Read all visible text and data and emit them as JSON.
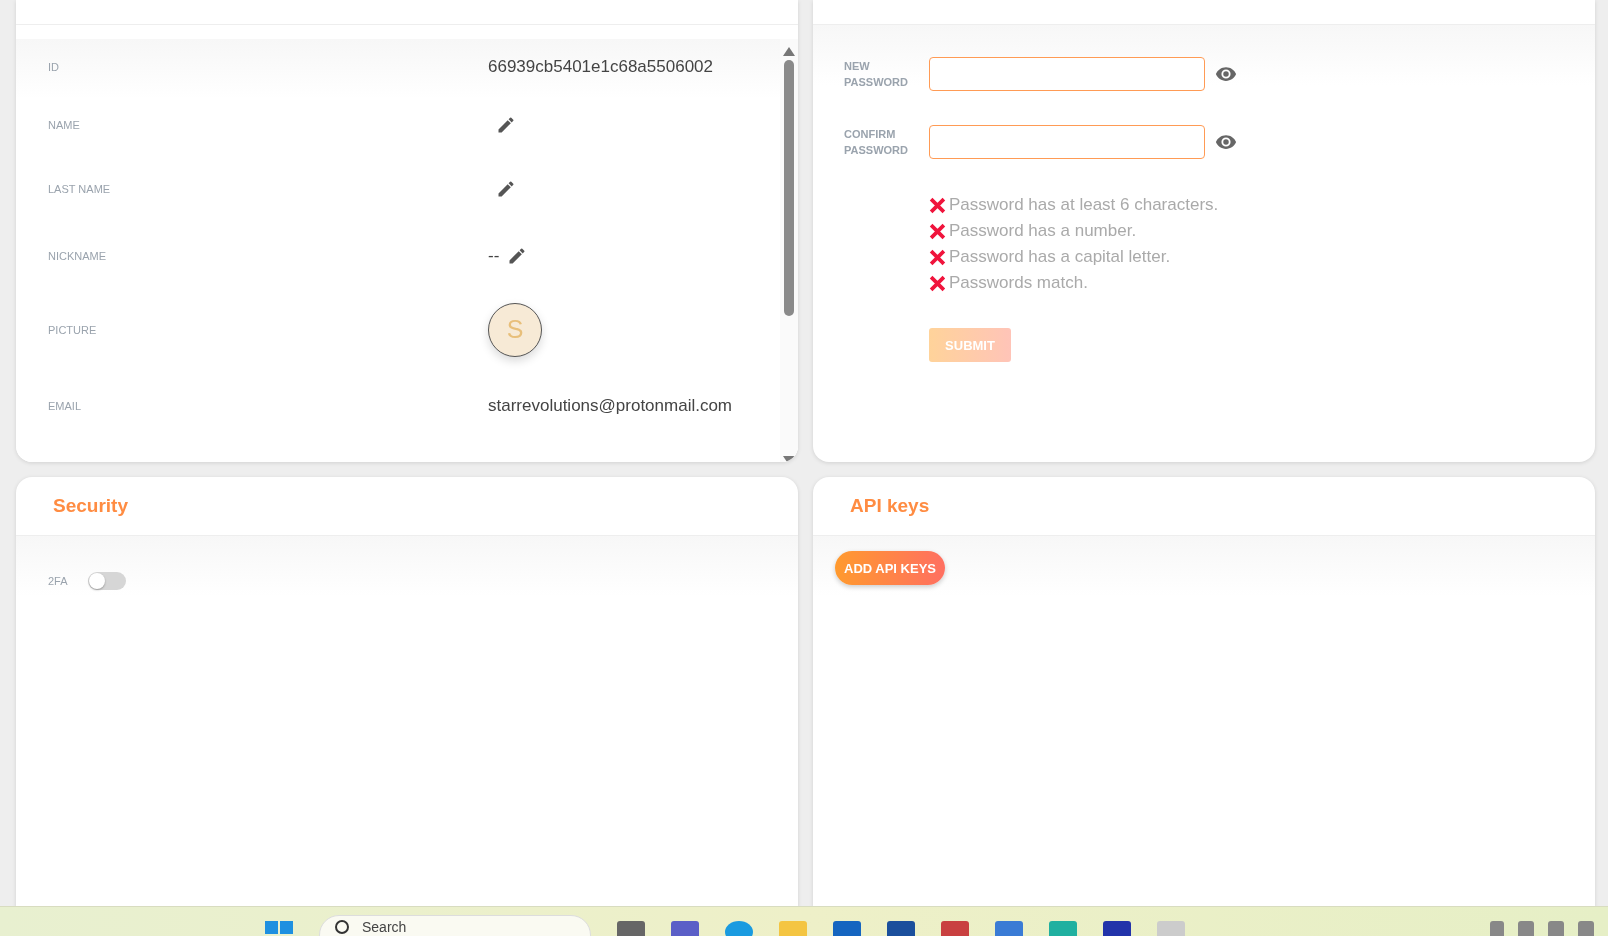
{
  "profile": {
    "fields": [
      {
        "label": "ID",
        "kind": "text",
        "value": "66939cb5401e1c68a5506002"
      },
      {
        "label": "NAME",
        "kind": "edit"
      },
      {
        "label": "LAST NAME",
        "kind": "edit"
      },
      {
        "label": "NICKNAME",
        "kind": "edit",
        "value": "--"
      },
      {
        "label": "PICTURE",
        "kind": "avatar",
        "value": "S"
      },
      {
        "label": "EMAIL",
        "kind": "text",
        "value": "starrevolutions@protonmail.com"
      }
    ]
  },
  "password": {
    "fields": [
      {
        "label": "NEW PASSWORD"
      },
      {
        "label": "CONFIRM PASSWORD"
      }
    ],
    "rules": [
      {
        "text": "Password has at least 6 characters.",
        "met": false
      },
      {
        "text": "Password has a number.",
        "met": false
      },
      {
        "text": "Password has a capital letter.",
        "met": false
      },
      {
        "text": "Passwords match.",
        "met": false
      }
    ],
    "submit": {
      "label": "SUBMIT",
      "disabled": true
    }
  },
  "security": {
    "title": "Security",
    "toggles": [
      {
        "label": "2FA",
        "on": false
      }
    ]
  },
  "api_keys": {
    "title": "API keys",
    "button": "ADD API KEYS"
  },
  "taskbar": {
    "search_placeholder": "Search"
  }
}
